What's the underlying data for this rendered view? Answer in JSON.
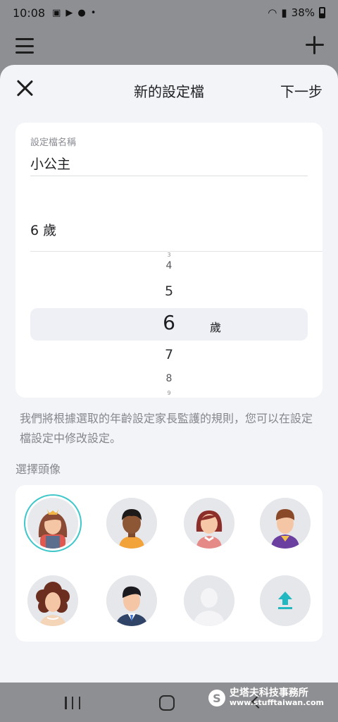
{
  "status_bar": {
    "time": "10:08",
    "battery": "38%"
  },
  "sheet": {
    "title": "新的設定檔",
    "next_label": "下一步"
  },
  "form": {
    "name_label": "設定檔名稱",
    "name_value": "小公主",
    "age_value": "6 歲",
    "picker": {
      "values": [
        "3",
        "4",
        "5",
        "6",
        "7",
        "8",
        "9"
      ],
      "selected": "6",
      "unit": "歲"
    }
  },
  "helper_text": "我們將根據選取的年齡設定家長監護的規則，您可以在設定檔設定中修改設定。",
  "avatar_section_label": "選擇頭像",
  "avatars": [
    {
      "name": "avatar-girl-crown",
      "selected": true
    },
    {
      "name": "avatar-boy-dark",
      "selected": false
    },
    {
      "name": "avatar-girl-red-hair",
      "selected": false
    },
    {
      "name": "avatar-boy-purple",
      "selected": false
    },
    {
      "name": "avatar-woman-curly",
      "selected": false
    },
    {
      "name": "avatar-man-suit",
      "selected": false
    },
    {
      "name": "avatar-placeholder",
      "selected": false
    },
    {
      "name": "upload-avatar",
      "selected": false
    }
  ],
  "watermark": {
    "title": "史塔夫科技事務所",
    "url": "www.stufftaiwan.com",
    "logo": "S"
  },
  "colors": {
    "accent": "#3fc7c9",
    "upload_icon": "#22b8c2"
  },
  "icons": [
    "menu-icon",
    "add-icon",
    "close-icon",
    "upload-icon",
    "nav-recent-icon",
    "nav-home-icon",
    "nav-back-icon"
  ]
}
